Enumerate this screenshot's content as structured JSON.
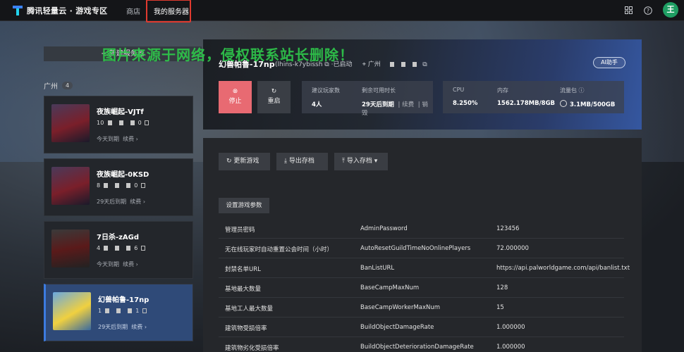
{
  "topbar": {
    "brand": "腾讯轻量云 · 游戏专区",
    "nav_store": "商店",
    "nav_my_servers": "我的服务器",
    "icons": [
      "grid-icon",
      "help-icon"
    ],
    "avatar_letter": "王"
  },
  "watermark": "图片来源于网络，侵权联系站长删除！",
  "sidebar": {
    "new_server": "+ 新建服务器",
    "region": "广州",
    "region_count": "4",
    "servers": [
      {
        "name": "夜族崛起-VJTf",
        "ip_start": "10",
        "ip_end": "0",
        "expiry": "今天到期",
        "renew": "续费 ›"
      },
      {
        "name": "夜族崛起-0KSD",
        "ip_start": "8",
        "ip_end": "0",
        "expiry": "29天后到期",
        "renew": "续费 ›"
      },
      {
        "name": "7日杀-zAGd",
        "ip_start": "4",
        "ip_end": "6",
        "expiry": "今天到期",
        "renew": "续费 ›"
      },
      {
        "name": "幻兽帕鲁-17np",
        "ip_start": "1",
        "ip_end": "1",
        "expiry": "29天后到期",
        "renew": "续费 ›"
      }
    ]
  },
  "hero": {
    "title": "幻兽帕鲁-17np",
    "instance_id": "(lhins-k7ybissh",
    "status": "·已启动",
    "region": "广州",
    "ai_button": "AI助手",
    "stop": "停止",
    "restart": "重启",
    "players_label": "建议玩家数",
    "players_value": "4人",
    "remaining_label": "剩余可用时长",
    "remaining_value": "29天后到期",
    "renew": "续费",
    "destroy": "销毁",
    "cpu_label": "CPU",
    "cpu_value": "8.250%",
    "mem_label": "内存",
    "mem_value": "1562.178MB/8GB",
    "traffic_label": "流量包",
    "traffic_value": "3.1MB/500GB"
  },
  "actions": {
    "update": "更新游戏",
    "export": "导出存档",
    "import": "导入存档 ▾",
    "settings": "设置游戏参数"
  },
  "params": [
    {
      "name": "管理员密码",
      "key": "AdminPassword",
      "value": "123456"
    },
    {
      "name": "无在线玩家时自动重置公会时间（小时）",
      "key": "AutoResetGuildTimeNoOnlinePlayers",
      "value": "72.000000"
    },
    {
      "name": "封禁名单URL",
      "key": "BanListURL",
      "value": "https://api.palworldgame.com/api/banlist.txt"
    },
    {
      "name": "基地最大数量",
      "key": "BaseCampMaxNum",
      "value": "128"
    },
    {
      "name": "基地工人最大数量",
      "key": "BaseCampWorkerMaxNum",
      "value": "15"
    },
    {
      "name": "建筑物受损倍率",
      "key": "BuildObjectDamageRate",
      "value": "1.000000"
    },
    {
      "name": "建筑物劣化受损倍率",
      "key": "BuildObjectDeteriorationDamageRate",
      "value": "1.000000"
    }
  ]
}
